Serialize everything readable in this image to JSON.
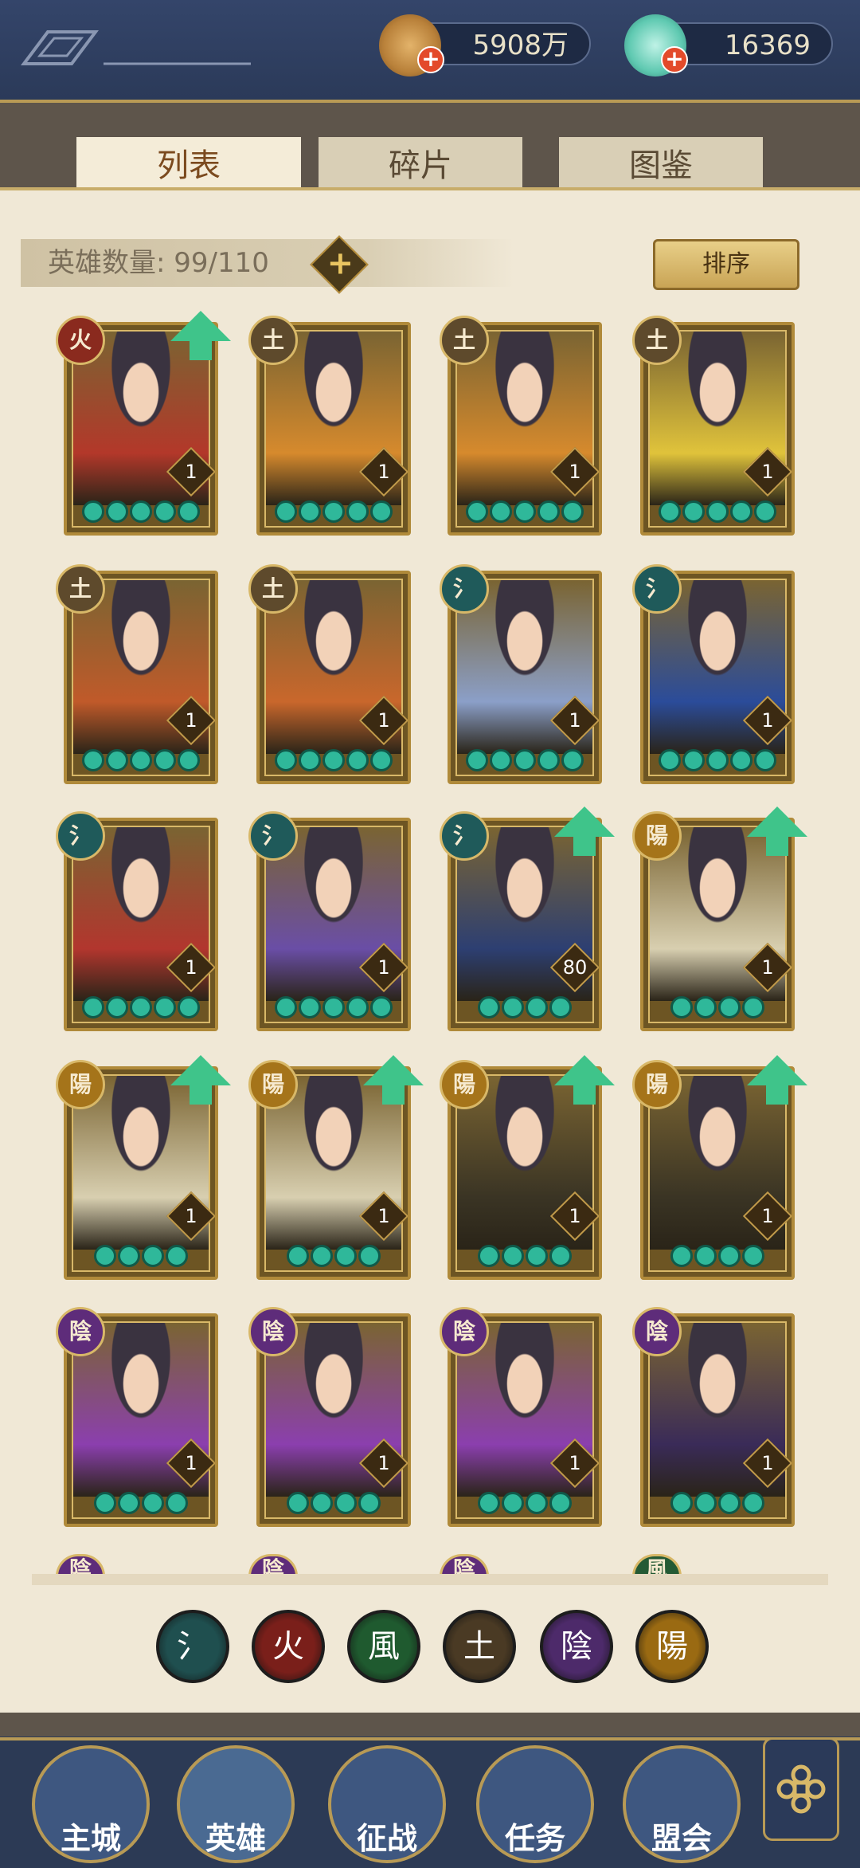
{
  "resources": {
    "coins": "5908万",
    "jade": "16369"
  },
  "tabs": [
    {
      "label": "列表",
      "active": true
    },
    {
      "label": "碎片",
      "active": false
    },
    {
      "label": "图鉴",
      "active": false
    }
  ],
  "hero_count": {
    "label": "英雄数量:",
    "value": "99/110"
  },
  "sort_label": "排序",
  "element_icons": {
    "water": "氵",
    "fire": "火",
    "wind": "風",
    "earth": "土",
    "yin": "陰",
    "yang": "陽"
  },
  "heroes": [
    {
      "element": "fire",
      "glyph": "火",
      "level": "1",
      "stars": 5,
      "upgrade": true,
      "palette": "#b3382a"
    },
    {
      "element": "earth",
      "glyph": "土",
      "level": "1",
      "stars": 5,
      "upgrade": false,
      "palette": "#d68a2d"
    },
    {
      "element": "earth",
      "glyph": "土",
      "level": "1",
      "stars": 5,
      "upgrade": false,
      "palette": "#d68a2d"
    },
    {
      "element": "earth",
      "glyph": "土",
      "level": "1",
      "stars": 5,
      "upgrade": false,
      "palette": "#e0c33b"
    },
    {
      "element": "earth",
      "glyph": "土",
      "level": "1",
      "stars": 5,
      "upgrade": false,
      "palette": "#c05a2a"
    },
    {
      "element": "earth",
      "glyph": "土",
      "level": "1",
      "stars": 5,
      "upgrade": false,
      "palette": "#c9672c"
    },
    {
      "element": "water",
      "glyph": "氵",
      "level": "1",
      "stars": 5,
      "upgrade": false,
      "palette": "#8b9fc8"
    },
    {
      "element": "water",
      "glyph": "氵",
      "level": "1",
      "stars": 5,
      "upgrade": false,
      "palette": "#2b4c9a"
    },
    {
      "element": "water",
      "glyph": "氵",
      "level": "1",
      "stars": 5,
      "upgrade": false,
      "palette": "#b2362e"
    },
    {
      "element": "water",
      "glyph": "氵",
      "level": "1",
      "stars": 5,
      "upgrade": false,
      "palette": "#6a4ea6"
    },
    {
      "element": "water",
      "glyph": "氵",
      "level": "80",
      "stars": 4,
      "upgrade": true,
      "palette": "#2d3f72"
    },
    {
      "element": "yang",
      "glyph": "陽",
      "level": "1",
      "stars": 4,
      "upgrade": true,
      "palette": "#d8cfb0"
    },
    {
      "element": "yang",
      "glyph": "陽",
      "level": "1",
      "stars": 4,
      "upgrade": true,
      "palette": "#d8cfb0"
    },
    {
      "element": "yang",
      "glyph": "陽",
      "level": "1",
      "stars": 4,
      "upgrade": true,
      "palette": "#d8cfb0"
    },
    {
      "element": "yang",
      "glyph": "陽",
      "level": "1",
      "stars": 4,
      "upgrade": true,
      "palette": "#3a3424"
    },
    {
      "element": "yang",
      "glyph": "陽",
      "level": "1",
      "stars": 4,
      "upgrade": true,
      "palette": "#3a3424"
    },
    {
      "element": "yin",
      "glyph": "陰",
      "level": "1",
      "stars": 4,
      "upgrade": false,
      "palette": "#8b3fae"
    },
    {
      "element": "yin",
      "glyph": "陰",
      "level": "1",
      "stars": 4,
      "upgrade": false,
      "palette": "#8b3fae"
    },
    {
      "element": "yin",
      "glyph": "陰",
      "level": "1",
      "stars": 4,
      "upgrade": false,
      "palette": "#8b3fae"
    },
    {
      "element": "yin",
      "glyph": "陰",
      "level": "1",
      "stars": 4,
      "upgrade": false,
      "palette": "#3a2b58"
    }
  ],
  "partial_row": [
    "陰",
    "陰",
    "陰",
    "風"
  ],
  "filters": [
    {
      "name": "water",
      "glyph": "氵",
      "color": "#1f4f4f"
    },
    {
      "name": "fire",
      "glyph": "火",
      "color": "#7a1f1a"
    },
    {
      "name": "wind",
      "glyph": "風",
      "color": "#1f5a2f"
    },
    {
      "name": "earth",
      "glyph": "土",
      "color": "#4a3a24"
    },
    {
      "name": "yin",
      "glyph": "陰",
      "color": "#4d2a6a"
    },
    {
      "name": "yang",
      "glyph": "陽",
      "color": "#9a6a12"
    }
  ],
  "nav": [
    {
      "label": "主城"
    },
    {
      "label": "英雄"
    },
    {
      "label": "征战"
    },
    {
      "label": "任务"
    },
    {
      "label": "盟会"
    }
  ],
  "colors": {
    "element_fire": "#8a2a1e",
    "element_earth": "#5e4a2c",
    "element_water": "#1f5a5a",
    "element_yin": "#5e2c7a",
    "element_yang": "#a5741a",
    "element_wind": "#245a34",
    "star_green": "#2fb89a",
    "upgrade_arrow": "#3fc48a"
  }
}
